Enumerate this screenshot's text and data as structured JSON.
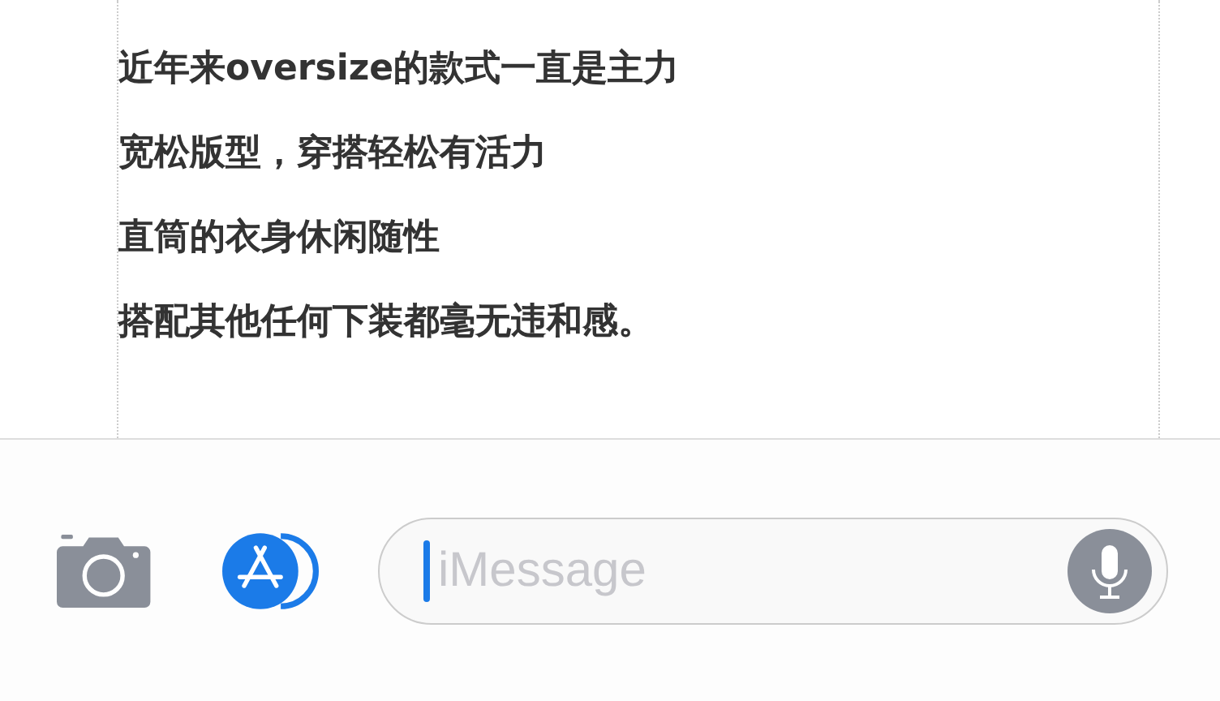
{
  "article": {
    "lines": [
      "近年来oversize的款式一直是主力",
      "宽松版型，穿搭轻松有活力",
      "直筒的衣身休闲随性",
      "搭配其他任何下装都毫无违和感。"
    ]
  },
  "message_bar": {
    "placeholder": "iMessage"
  }
}
